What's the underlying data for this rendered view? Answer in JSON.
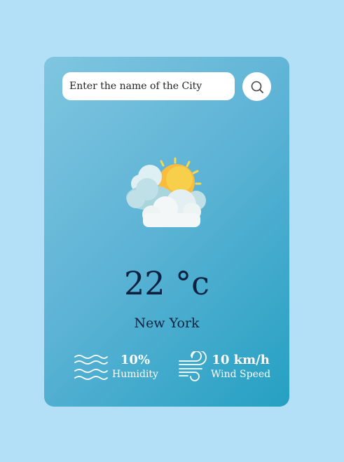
{
  "search": {
    "placeholder": "Enter the name of the City",
    "button_icon": "search-icon"
  },
  "weather": {
    "icon": "sun-behind-clouds-icon",
    "temperature": "22 °c",
    "city": "New York"
  },
  "stats": {
    "humidity": {
      "value": "10%",
      "label": "Humidity",
      "icon": "waves-icon"
    },
    "wind": {
      "value": "10 km/h",
      "label": "Wind Speed",
      "icon": "wind-icon"
    }
  },
  "colors": {
    "background": "#b3e0f7",
    "card_gradient_start": "#7fc6e0",
    "card_gradient_end": "#25a0c2",
    "text_dark": "#0b2340",
    "sun": "#fbbc3c"
  }
}
